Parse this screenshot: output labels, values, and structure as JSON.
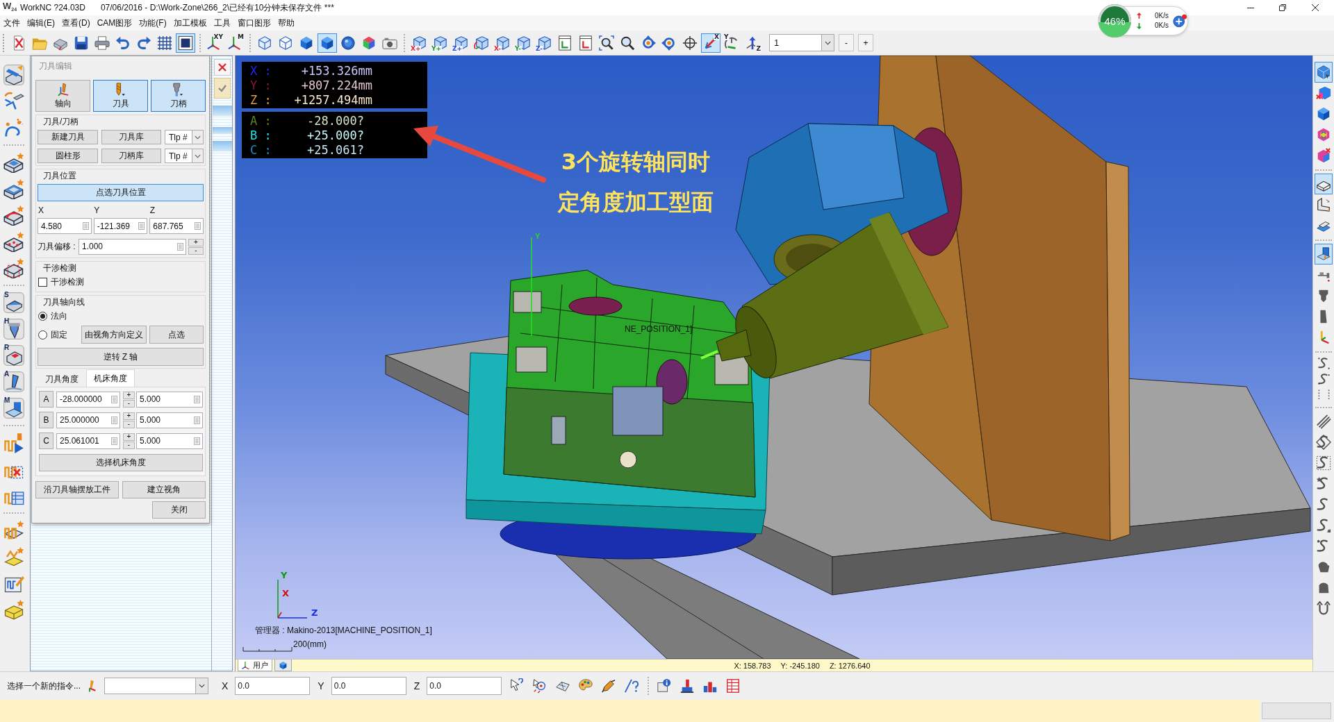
{
  "window": {
    "logo": "W$_{24}$",
    "app_name": "WorkNC ?24.03D",
    "document": "07/06/2016 - D:\\Work-Zone\\266_2\\已经有10分钟未保存文件 ***"
  },
  "network_widget": {
    "percent": "46%",
    "level": 0.46,
    "upload": "0K/s",
    "download": "0K/s"
  },
  "menu": [
    "文件",
    "编辑(E)",
    "查看(D)",
    "CAM图形",
    "功能(F)",
    "加工模板",
    "工具",
    "窗口图形",
    "帮助"
  ],
  "toolbar": {
    "items": [
      {
        "selected": false
      },
      {
        "selected": false
      },
      {
        "selected": false
      },
      {
        "selected": false
      },
      {
        "selected": false
      },
      {
        "selected": false
      },
      {
        "selected": false
      },
      {
        "selected": false
      },
      {
        "selected": true
      },
      {
        "selected": false,
        "label": "XY"
      },
      {
        "selected": false,
        "label": "M"
      },
      {
        "selected": false
      },
      {
        "selected": false
      },
      {
        "selected": false
      },
      {
        "selected": true
      },
      {
        "selected": false
      },
      {
        "selected": false
      },
      {
        "selected": false
      },
      {
        "selected": false,
        "label": "X+",
        "color": "#e3262b"
      },
      {
        "selected": false,
        "label": "Y+",
        "color": "#1c9a2a"
      },
      {
        "selected": false,
        "label": "Z+",
        "color": "#2546d8"
      },
      {
        "selected": false
      },
      {
        "selected": false,
        "label": "X-",
        "color": "#e3262b"
      },
      {
        "selected": false,
        "label": "Y-",
        "color": "#1c9a2a"
      },
      {
        "selected": false,
        "label": "Z-",
        "color": "#2546d8"
      },
      {
        "selected": false
      },
      {
        "selected": false
      },
      {
        "selected": false
      },
      {
        "selected": false
      },
      {
        "selected": false
      },
      {
        "selected": false
      },
      {
        "selected": false
      },
      {
        "selected": true,
        "label": "X"
      },
      {
        "selected": false,
        "label": "Y"
      },
      {
        "selected": false,
        "label": "Z"
      }
    ],
    "view_select": {
      "value": "1"
    },
    "step_buttons": [
      "-",
      "+"
    ]
  },
  "left_toolbar": {
    "badges": [
      "S",
      "H",
      "R",
      "A",
      "M"
    ]
  },
  "tool_dialog": {
    "title": "刀具编辑",
    "mode_buttons": [
      {
        "label": "轴向",
        "selected": false
      },
      {
        "label": "刀具",
        "selected": true
      },
      {
        "label": "刀柄",
        "selected": true
      }
    ],
    "tool_group": {
      "title": "刀具/刀柄",
      "rows": [
        {
          "button": "新建刀具",
          "library": "刀具库",
          "select": "Tlp #"
        },
        {
          "button": "圆柱形",
          "library": "刀柄库",
          "select": "Tlp #"
        }
      ]
    },
    "position_group": {
      "title": "刀具位置",
      "pick_button": "点选刀具位置",
      "fields": [
        {
          "label": "X",
          "value": "4.580"
        },
        {
          "label": "Y",
          "value": "-121.369"
        },
        {
          "label": "Z",
          "value": "687.765"
        }
      ],
      "offset": {
        "label": "刀具偏移 :",
        "value": "1.000",
        "plus": "+",
        "minus": "-"
      }
    },
    "collision_group": {
      "title": "干涉检测",
      "checkbox": {
        "label": "干涉检测",
        "checked": false
      }
    },
    "axis_group": {
      "title": "刀具轴向线",
      "options": [
        {
          "label": "法向",
          "selected": true
        },
        {
          "label": "固定",
          "selected": false
        }
      ],
      "view_button": "由视角方向定义",
      "pick_button": "点选",
      "reverse_button": "逆转 Z 轴"
    },
    "angle_tabs": [
      {
        "label": "刀具角度",
        "selected": false
      },
      {
        "label": "机床角度",
        "selected": true
      }
    ],
    "angles": [
      {
        "axis": "A",
        "value": "-28.000000",
        "plus": "+",
        "minus": "-",
        "step": "5.000"
      },
      {
        "axis": "B",
        "value": "25.000000",
        "plus": "+",
        "minus": "-",
        "step": "5.000"
      },
      {
        "axis": "C",
        "value": "25.061001",
        "plus": "+",
        "minus": "-",
        "step": "5.000"
      }
    ],
    "select_angle_button": "选择机床角度",
    "footer_buttons": [
      "沿刀具轴摆放工件",
      "建立视角"
    ],
    "close_button": "关闭"
  },
  "viewport": {
    "readout": {
      "position": [
        {
          "axis": "X :",
          "value": "+153.326mm",
          "color": "#2323ff"
        },
        {
          "axis": "Y :",
          "value": "+807.224mm",
          "color": "#8c1040"
        },
        {
          "axis": "Z :",
          "value": "+1257.494mm",
          "color": "#e89a3a"
        }
      ],
      "angles": [
        {
          "axis": "A :",
          "value": "-28.000?",
          "color": "#5c8a1e"
        },
        {
          "axis": "B :",
          "value": "+25.000?",
          "color": "#18e6ee"
        },
        {
          "axis": "C :",
          "value": "+25.061?",
          "color": "#168fc8"
        }
      ]
    },
    "annotation": [
      "3个旋转轴同时",
      "定角度加工型面"
    ],
    "part_axis_label": "Y",
    "part_label": "NE_POSITION_1]",
    "triad": [
      {
        "label": "Y",
        "color": "#0e9a0e"
      },
      {
        "label": "X",
        "color": "#d01010"
      },
      {
        "label": "Z",
        "color": "#1a30e0"
      }
    ],
    "manager": "管理器 : Makino-2013[MACHINE_POSITION_1]",
    "scale": "200(mm)",
    "tabs": [
      {
        "label": "用户",
        "selected": true
      },
      {
        "selected": false
      }
    ],
    "cursor": [
      "X: 158.783",
      "Y: -245.180",
      "Z: 1276.640"
    ]
  },
  "right_toolbar": {
    "items": [
      {
        "selected": true
      },
      {
        "selected": false
      },
      {
        "selected": false
      },
      {
        "selected": false
      },
      {
        "selected": false
      },
      {
        "selected": true
      },
      {
        "selected": false
      },
      {
        "selected": false
      },
      {
        "selected": true
      },
      {
        "selected": false
      },
      {
        "selected": false
      },
      {
        "selected": false
      },
      {
        "selected": false
      },
      {
        "selected": false
      },
      {
        "selected": false
      },
      {
        "selected": false
      },
      {
        "selected": false
      },
      {
        "selected": false
      },
      {
        "selected": false
      },
      {
        "selected": false
      },
      {
        "selected": false
      },
      {
        "selected": false
      },
      {
        "selected": false
      },
      {
        "selected": false
      },
      {
        "selected": false
      },
      {
        "selected": false
      }
    ]
  },
  "command_bar": {
    "prompt": "选择一个新的指令...",
    "coords": [
      {
        "label": "X",
        "value": "0.0"
      },
      {
        "label": "Y",
        "value": "0.0"
      },
      {
        "label": "Z",
        "value": "0.0"
      }
    ]
  }
}
